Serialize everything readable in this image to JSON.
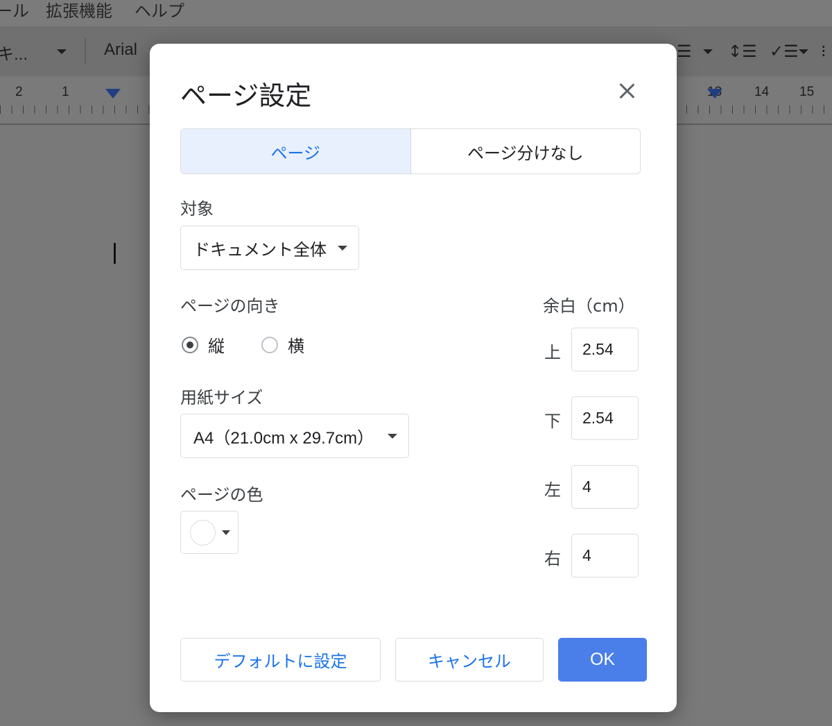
{
  "app": {
    "menus": [
      "ール",
      "拡張機能",
      "ヘルプ"
    ],
    "toolbar": {
      "style_label": "キ...",
      "font_label": "Arial"
    },
    "ruler_numbers": [
      "2",
      "1",
      "13",
      "14",
      "15"
    ]
  },
  "dialog": {
    "title": "ページ設定",
    "tabs": [
      "ページ",
      "ページ分けなし"
    ],
    "apply_to": {
      "label": "対象",
      "value": "ドキュメント全体"
    },
    "orientation": {
      "label": "ページの向き",
      "options": [
        "縦",
        "横"
      ],
      "selected": "縦"
    },
    "paper_size": {
      "label": "用紙サイズ",
      "value": "A4（21.0cm x 29.7cm）"
    },
    "page_color": {
      "label": "ページの色",
      "color": "#ffffff"
    },
    "margins": {
      "label": "余白（cm）",
      "top": {
        "label": "上",
        "value": "2.54"
      },
      "bottom": {
        "label": "下",
        "value": "2.54"
      },
      "left": {
        "label": "左",
        "value": "4"
      },
      "right": {
        "label": "右",
        "value": "4"
      }
    },
    "buttons": {
      "default": "デフォルトに設定",
      "cancel": "キャンセル",
      "ok": "OK"
    }
  },
  "colors": {
    "accent": "#1a73e8",
    "primary_button": "#4a7ee8",
    "active_tab_bg": "#e8f0fe"
  }
}
